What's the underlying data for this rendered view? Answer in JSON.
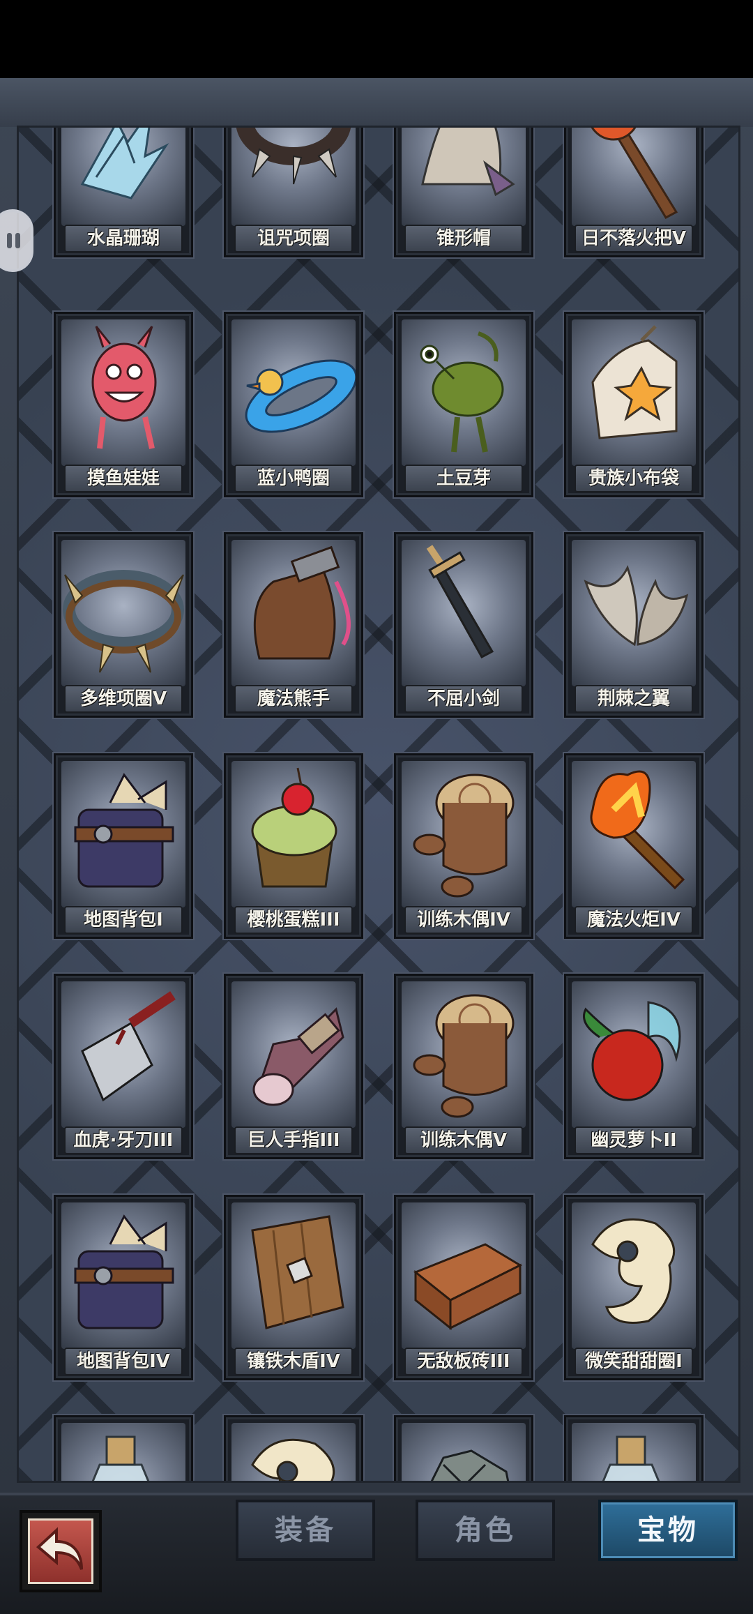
{
  "items": [
    {
      "name": "水晶珊瑚",
      "icon": "crystal-coral-icon"
    },
    {
      "name": "诅咒项圈",
      "icon": "spiked-collar-icon"
    },
    {
      "name": "锥形帽",
      "icon": "cone-helmet-icon"
    },
    {
      "name": "日不落火把V",
      "icon": "torch-icon"
    },
    {
      "name": "摸鱼娃娃",
      "icon": "pink-doll-icon"
    },
    {
      "name": "蓝小鸭圈",
      "icon": "duck-float-icon"
    },
    {
      "name": "土豆芽",
      "icon": "potato-sprout-icon"
    },
    {
      "name": "贵族小布袋",
      "icon": "cloth-bag-icon"
    },
    {
      "name": "多维项圈V",
      "icon": "multi-collar-icon"
    },
    {
      "name": "魔法熊手",
      "icon": "bear-paw-icon"
    },
    {
      "name": "不屈小剑",
      "icon": "small-sword-icon"
    },
    {
      "name": "荆棘之翼",
      "icon": "thorn-wings-icon"
    },
    {
      "name": "地图背包I",
      "icon": "map-backpack-icon"
    },
    {
      "name": "樱桃蛋糕III",
      "icon": "cherry-cake-icon"
    },
    {
      "name": "训练木偶IV",
      "icon": "training-dummy-icon"
    },
    {
      "name": "魔法火炬IV",
      "icon": "magic-torch-icon"
    },
    {
      "name": "血虎·牙刀III",
      "icon": "cleaver-icon"
    },
    {
      "name": "巨人手指III",
      "icon": "giant-finger-icon"
    },
    {
      "name": "训练木偶V",
      "icon": "training-dummy-icon"
    },
    {
      "name": "幽灵萝卜II",
      "icon": "ghost-radish-icon"
    },
    {
      "name": "地图背包IV",
      "icon": "map-backpack-icon"
    },
    {
      "name": "镶铁木盾IV",
      "icon": "wooden-shield-icon"
    },
    {
      "name": "无敌板砖III",
      "icon": "brick-icon"
    },
    {
      "name": "微笑甜甜圈I",
      "icon": "donut-icon"
    },
    {
      "name": "",
      "icon": "bottle-icon"
    },
    {
      "name": "",
      "icon": "donut-icon"
    },
    {
      "name": "",
      "icon": "rock-icon"
    },
    {
      "name": "",
      "icon": "bottle-icon"
    }
  ],
  "tabs": [
    {
      "label": "装备",
      "active": false
    },
    {
      "label": "角色",
      "active": false
    },
    {
      "label": "宝物",
      "active": true
    }
  ],
  "colors": {
    "active_tab": "#2f6f9a",
    "frame": "#3a4453"
  }
}
